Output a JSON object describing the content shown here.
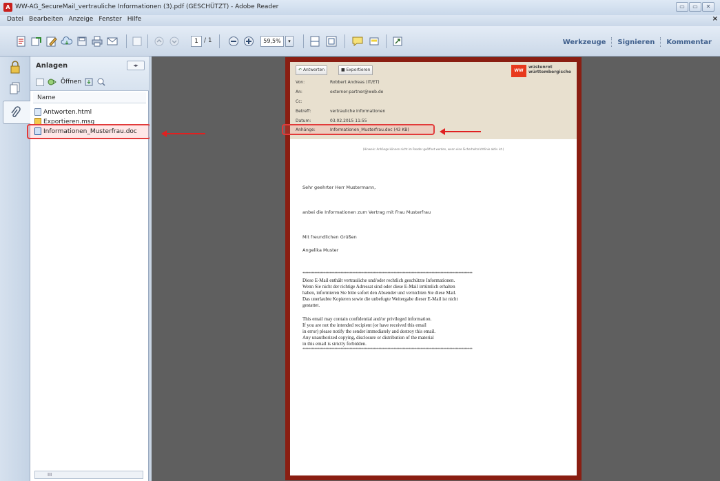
{
  "window": {
    "title": "WW-AG_SecureMail_vertrauliche Informationen (3).pdf (GESCHÜTZT) - Adobe Reader",
    "app_icon_glyph": "A",
    "buttons": [
      "▭",
      "▭",
      "✕"
    ]
  },
  "menubar": {
    "items": [
      "Datei",
      "Bearbeiten",
      "Anzeige",
      "Fenster",
      "Hilfe"
    ],
    "close": "×"
  },
  "toolbar": {
    "page_current": "1",
    "page_total": "/ 1",
    "zoom": "59,5%",
    "zoom_drop": "▾",
    "tools_label": "Werkzeuge",
    "sign_label": "Signieren",
    "comment_label": "Kommentar"
  },
  "panel": {
    "title": "Anlagen",
    "collapse_glyph": "◂▸",
    "open_label": "Öffnen",
    "column_name": "Name",
    "files": [
      {
        "name": "Antworten.html",
        "icon": "html-file-icon"
      },
      {
        "name": "Exportieren.msg",
        "icon": "msg-file-icon"
      },
      {
        "name": "Informationen_Musterfrau.doc",
        "icon": "doc-file-icon"
      }
    ],
    "scrollbar_label": "III"
  },
  "mail": {
    "btn_reply": "Antworten",
    "btn_export": "Exportieren",
    "logo_line1": "wüstenrot",
    "logo_line2": "württembergische",
    "logo_mark": "WW",
    "rows": [
      {
        "label": "Von:",
        "value": "Robbert Andreas (IT/ET)"
      },
      {
        "label": "An:",
        "value": "externer-partner@web.de"
      },
      {
        "label": "Cc:",
        "value": ""
      },
      {
        "label": "Betreff:",
        "value": "vertrauliche Informationen"
      },
      {
        "label": "Datum:",
        "value": "03.02.2015 11:55"
      },
      {
        "label": "Anhänge:",
        "value": "Informationen_Musterfrau.doc (43 KB)"
      }
    ],
    "note": "(Hinweis: Anhänge können nicht im Reader geöffnet werden, wenn eine Sicherheitsrichtlinie aktiv ist.)",
    "salutation": "Sehr geehrter Herr Mustermann,",
    "body": "anbei die Informationen zum Vertrag mit Frau Musterfrau",
    "closing": "Mit freundlichen Grüßen",
    "signature": "Angelika Muster",
    "stars": "****************************************************************************************************************",
    "disclaimer_de": [
      "Diese E-Mail enthält vertrauliche und/oder rechtlich geschützte Informationen.",
      "Wenn Sie nicht der richtige Adressat sind oder diese E-Mail irrtümlich erhalten",
      "haben, informieren Sie bitte sofort den Absender und vernichten Sie diese Mail.",
      "Das unerlaubte Kopieren sowie die unbefugte Weitergabe dieser E-Mail ist nicht",
      "gestattet."
    ],
    "disclaimer_en": [
      "This email may contain confidential and/or privileged information.",
      "If you are not the intended recipient (or have received this email",
      "in error) please notify the sender immediately and destroy this email.",
      "Any unauthorized copying, disclosure or distribution of the material",
      "in this email is strictly forbidden."
    ]
  },
  "colors": {
    "highlight": "#e23a3a",
    "doc_frame": "#8a1e12",
    "canvas": "#5f5f5f",
    "link": "#3f5f8c"
  }
}
